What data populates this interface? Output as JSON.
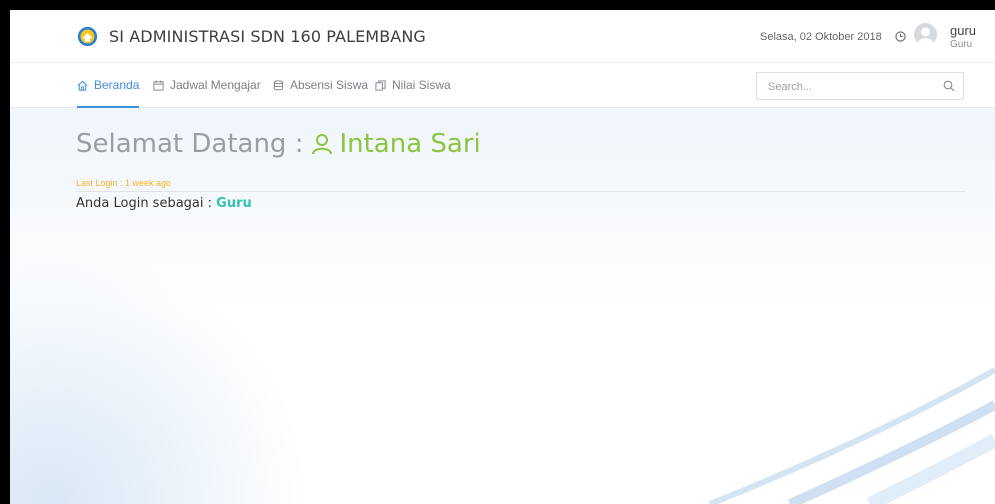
{
  "app": {
    "title": "SI ADMINISTRASI SDN 160 PALEMBANG",
    "brand_colors": {
      "accent": "#3f8fdc",
      "name_green": "#8cc63f",
      "role_teal": "#35c0b0",
      "last_login_amber": "#f0b429"
    }
  },
  "header": {
    "date": "Selasa, 02 Oktober 2018",
    "date_icon": "clock-icon",
    "user": {
      "name": "guru",
      "role": "Guru",
      "avatar_icon": "user-avatar-icon"
    }
  },
  "nav": {
    "items": [
      {
        "label": "Beranda",
        "icon": "home-icon",
        "active": true
      },
      {
        "label": "Jadwal Mengajar",
        "icon": "calendar-icon",
        "active": false
      },
      {
        "label": "Absensi Siswa",
        "icon": "database-icon",
        "active": false
      },
      {
        "label": "Nilai Siswa",
        "icon": "copy-icon",
        "active": false
      }
    ],
    "search": {
      "placeholder": "Search...",
      "value": ""
    }
  },
  "main": {
    "welcome_prefix": "Selamat Datang :",
    "user_full_name": "Intana Sari",
    "last_login": "Last Login : 1 week ago",
    "role_prefix": "Anda Login sebagai :",
    "role": "Guru"
  }
}
